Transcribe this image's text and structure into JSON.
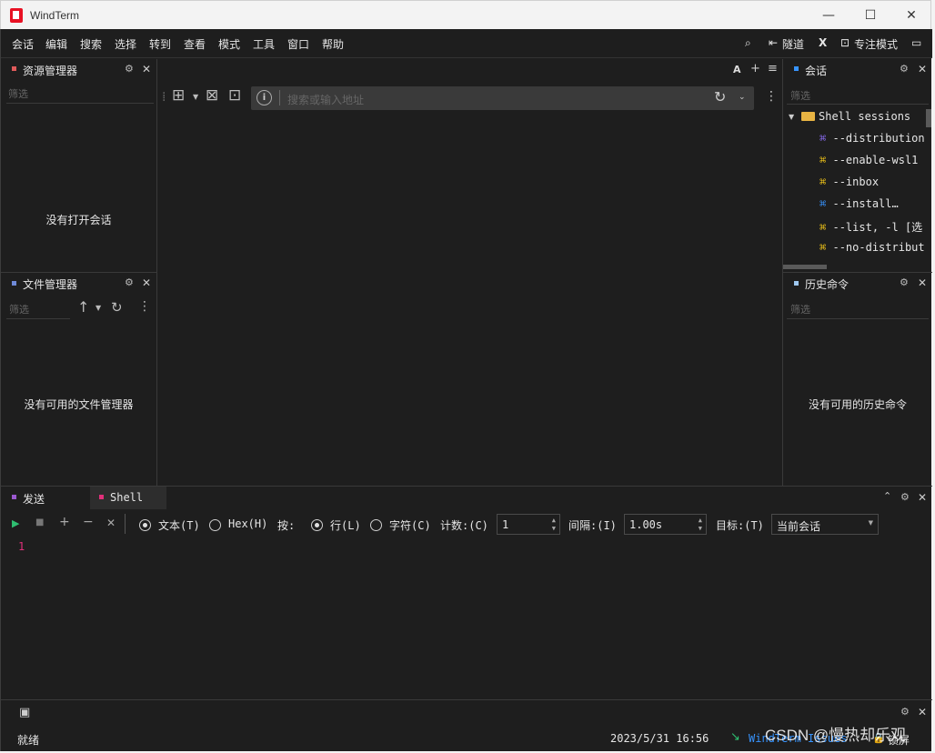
{
  "window": {
    "title": "WindTerm",
    "minimize": "—",
    "maximize": "☐",
    "close": "✕"
  },
  "menu": {
    "items": [
      "会话",
      "编辑",
      "搜索",
      "选择",
      "转到",
      "查看",
      "模式",
      "工具",
      "窗口",
      "帮助"
    ],
    "tunnel": "隧道",
    "focus_mode": "专注模式",
    "x_label": "X"
  },
  "explorer": {
    "title": "资源管理器",
    "filter_placeholder": "筛选",
    "empty": "没有打开会话"
  },
  "file_manager": {
    "title": "文件管理器",
    "filter_placeholder": "筛选",
    "empty": "没有可用的文件管理器"
  },
  "editor": {
    "search_placeholder": "搜索或输入地址",
    "font_label": "A"
  },
  "sessions": {
    "title": "会话",
    "filter_placeholder": "筛选",
    "group": "Shell sessions",
    "items": [
      {
        "label": "--distribution",
        "color": "#8a6cf0"
      },
      {
        "label": "--enable-wsl1",
        "color": "#f0c419"
      },
      {
        "label": "--inbox",
        "color": "#f0c419"
      },
      {
        "label": "--install…",
        "color": "#3794ff"
      },
      {
        "label": "--list, -l [选",
        "color": "#f0c419"
      },
      {
        "label": "--no-distribut",
        "color": "#f0c419"
      }
    ]
  },
  "history": {
    "title": "历史命令",
    "filter_placeholder": "筛选",
    "empty": "没有可用的历史命令"
  },
  "send": {
    "tab_send": "发送",
    "tab_shell": "Shell",
    "text_option": "文本(T)",
    "hex_option": "Hex(H)",
    "by_label": "按:",
    "line_option": "行(L)",
    "char_option": "字符(C)",
    "count_label": "计数:(C)",
    "count_value": "1",
    "interval_label": "间隔:(I)",
    "interval_value": "1.00s",
    "target_label": "目标:(T)",
    "target_value": "当前会话",
    "line_number": "1"
  },
  "status": {
    "ready": "就绪",
    "datetime": "2023/5/31 16:56",
    "app": "WindTerm Issues",
    "lock": "锁屏"
  },
  "watermark": "CSDN @慢热却乐观",
  "colors": {
    "accent_red": "#e81123",
    "send_purple": "#9b59d0",
    "shell_pink": "#e0307a",
    "line_number": "#e0307a",
    "status_green": "#2fbf71"
  }
}
